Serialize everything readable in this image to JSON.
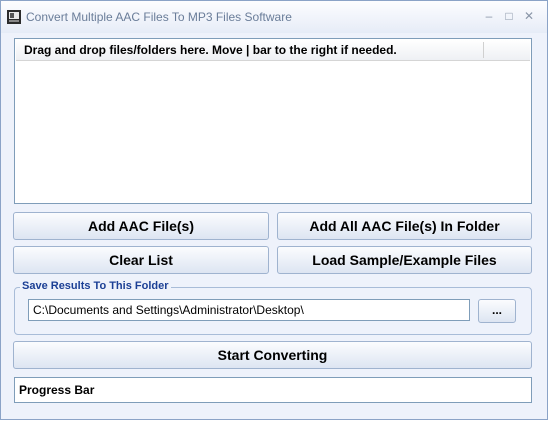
{
  "window": {
    "title": "Convert Multiple AAC Files To MP3 Files Software",
    "minimize_glyph": "–",
    "maximize_glyph": "□",
    "close_glyph": "✕"
  },
  "file_list": {
    "header": "Drag and drop files/folders here. Move | bar to the right if needed."
  },
  "buttons": {
    "add_files": "Add AAC File(s)",
    "add_folder": "Add All AAC File(s) In Folder",
    "clear_list": "Clear List",
    "load_samples": "Load Sample/Example Files",
    "browse": "...",
    "start": "Start Converting"
  },
  "output": {
    "group_label": "Save Results To This Folder",
    "folder_path": "C:\\Documents and Settings\\Administrator\\Desktop\\"
  },
  "progress": {
    "label": "Progress Bar"
  }
}
